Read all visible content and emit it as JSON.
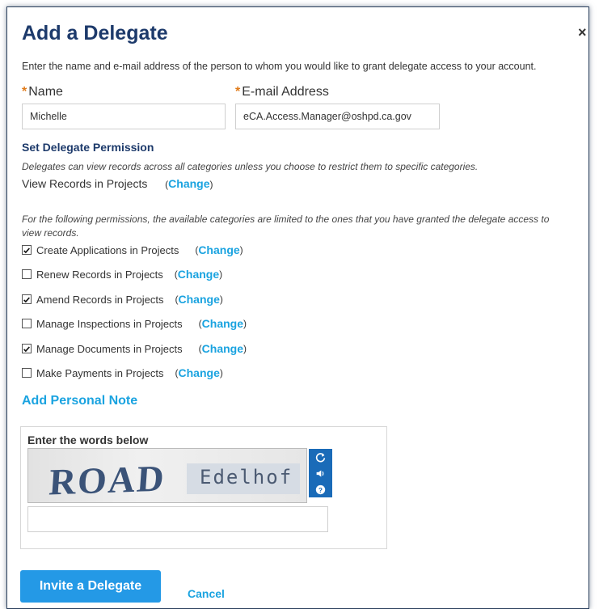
{
  "dialog": {
    "title": "Add a Delegate",
    "close_glyph": "×",
    "intro": "Enter the name and e-mail address of the person to whom you would like to grant delegate access to your account."
  },
  "form": {
    "required_marker": "*",
    "name_label": "Name",
    "name_value": "Michelle",
    "email_label": "E-mail Address",
    "email_value": "eCA.Access.Manager@oshpd.ca.gov"
  },
  "permissions": {
    "heading": "Set Delegate Permission",
    "view_note": "Delegates can view records across all categories unless you choose to restrict them to specific categories.",
    "view_label": "View Records in Projects",
    "change_link": "Change",
    "paren_open": "(",
    "paren_close": ")",
    "limit_note_1": "For the following permissions, the available categories are limited to the ones that you have granted the delegate access to",
    "limit_note_2": "view records.",
    "items": [
      {
        "label": "Create Applications in Projects",
        "checked": true
      },
      {
        "label": "Renew Records in Projects",
        "checked": false
      },
      {
        "label": "Amend Records in Projects",
        "checked": true
      },
      {
        "label": "Manage Inspections in Projects",
        "checked": false
      },
      {
        "label": "Manage Documents in Projects",
        "checked": true
      },
      {
        "label": "Make Payments in Projects",
        "checked": false
      }
    ]
  },
  "personal_note": "Add Personal Note",
  "captcha": {
    "label": "Enter the words below",
    "word_1": "ROAD",
    "word_2": "Edelhof",
    "refresh_icon": "refresh-icon",
    "audio_icon": "speaker-icon",
    "help_icon": "question-icon",
    "input_value": ""
  },
  "actions": {
    "invite_label": "Invite a Delegate",
    "cancel_label": "Cancel"
  },
  "colors": {
    "title": "#1d3a6b",
    "link": "#1aa3e0",
    "button": "#2499e6",
    "required": "#e07b1a"
  }
}
